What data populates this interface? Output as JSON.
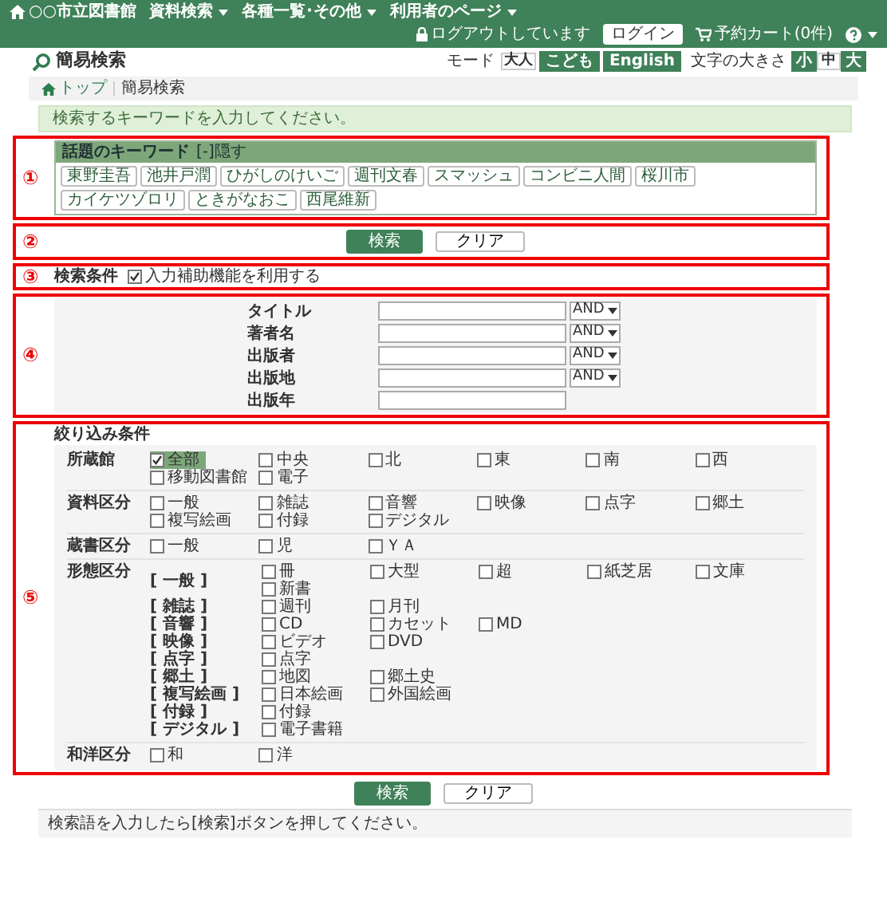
{
  "navbar": {
    "brand": "○○市立図書館",
    "menus": [
      {
        "label": "資料検索"
      },
      {
        "label": "各種一覧･その他"
      },
      {
        "label": "利用者のページ"
      }
    ],
    "login_status": "ログアウトしています",
    "login_button": "ログイン",
    "cart": "予約カート(0件)"
  },
  "page_title": "簡易検索",
  "mode": {
    "label": "モード",
    "options": [
      {
        "label": "大人",
        "selected": true
      },
      {
        "label": "こども",
        "selected": false
      },
      {
        "label": "English",
        "selected": false
      }
    ]
  },
  "font_size": {
    "label": "文字の大きさ",
    "options": [
      {
        "label": "小",
        "selected": false
      },
      {
        "label": "中",
        "selected": true
      },
      {
        "label": "大",
        "selected": false
      }
    ]
  },
  "breadcrumb": [
    {
      "label": "トップ"
    },
    {
      "label": "簡易検索"
    }
  ],
  "message": "検索するキーワードを入力してください。",
  "keywords": {
    "marker": "①",
    "title": "話題のキーワード",
    "toggle": "[-]隠す",
    "items": [
      "東野圭吾",
      "池井戸潤",
      "ひがしのけいご",
      "週刊文春",
      "スマッシュ",
      "コンビニ人間",
      "桜川市",
      "カイケツゾロリ",
      "ときがなおこ",
      "西尾維新"
    ]
  },
  "actions_top": {
    "marker": "②",
    "search": "検索",
    "clear": "クリア"
  },
  "conditions": {
    "marker": "③",
    "label": "検索条件",
    "assist": {
      "label": "入力補助機能を利用する",
      "checked": true
    }
  },
  "fields": {
    "marker": "④",
    "rows": [
      {
        "label": "タイトル",
        "operator": "AND"
      },
      {
        "label": "著者名",
        "operator": "AND"
      },
      {
        "label": "出版者",
        "operator": "AND"
      },
      {
        "label": "出版地",
        "operator": "AND"
      },
      {
        "label": "出版年"
      }
    ]
  },
  "filters": {
    "marker": "⑤",
    "title": "絞り込み条件",
    "groups": [
      {
        "kind": "simple",
        "label": "所蔵館",
        "options": [
          {
            "label": "全部",
            "checked": true
          },
          {
            "label": "中央",
            "checked": false
          },
          {
            "label": "北",
            "checked": false
          },
          {
            "label": "東",
            "checked": false
          },
          {
            "label": "南",
            "checked": false
          },
          {
            "label": "西",
            "checked": false
          },
          {
            "label": "移動図書館",
            "checked": false
          },
          {
            "label": "電子",
            "checked": false
          }
        ]
      },
      {
        "kind": "simple",
        "label": "資料区分",
        "options": [
          {
            "label": "一般",
            "checked": false
          },
          {
            "label": "雑誌",
            "checked": false
          },
          {
            "label": "音響",
            "checked": false
          },
          {
            "label": "映像",
            "checked": false
          },
          {
            "label": "点字",
            "checked": false
          },
          {
            "label": "郷土",
            "checked": false
          },
          {
            "label": "複写絵画",
            "checked": false
          },
          {
            "label": "付録",
            "checked": false
          },
          {
            "label": "デジタル",
            "checked": false
          }
        ]
      },
      {
        "kind": "simple",
        "label": "蔵書区分",
        "options": [
          {
            "label": "一般",
            "checked": false
          },
          {
            "label": "児",
            "checked": false
          },
          {
            "label": "ＹＡ",
            "checked": false
          }
        ]
      },
      {
        "kind": "nested",
        "label": "形態区分",
        "subgroups": [
          {
            "label": "[ 一般 ]",
            "options": [
              {
                "label": "冊",
                "checked": false
              },
              {
                "label": "大型",
                "checked": false
              },
              {
                "label": "超",
                "checked": false
              },
              {
                "label": "紙芝居",
                "checked": false
              },
              {
                "label": "文庫",
                "checked": false
              },
              {
                "label": "新書",
                "checked": false
              }
            ]
          },
          {
            "label": "[ 雑誌 ]",
            "options": [
              {
                "label": "週刊",
                "checked": false
              },
              {
                "label": "月刊",
                "checked": false
              }
            ]
          },
          {
            "label": "[ 音響 ]",
            "options": [
              {
                "label": "CD",
                "checked": false
              },
              {
                "label": "カセット",
                "checked": false
              },
              {
                "label": "MD",
                "checked": false
              }
            ]
          },
          {
            "label": "[ 映像 ]",
            "options": [
              {
                "label": "ビデオ",
                "checked": false
              },
              {
                "label": "DVD",
                "checked": false
              }
            ]
          },
          {
            "label": "[ 点字 ]",
            "options": [
              {
                "label": "点字",
                "checked": false
              }
            ]
          },
          {
            "label": "[ 郷土 ]",
            "options": [
              {
                "label": "地図",
                "checked": false
              },
              {
                "label": "郷土史",
                "checked": false
              }
            ]
          },
          {
            "label": "[ 複写絵画 ]",
            "options": [
              {
                "label": "日本絵画",
                "checked": false
              },
              {
                "label": "外国絵画",
                "checked": false
              }
            ]
          },
          {
            "label": "[ 付録 ]",
            "options": [
              {
                "label": "付録",
                "checked": false
              }
            ]
          },
          {
            "label": "[ デジタル ]",
            "options": [
              {
                "label": "電子書籍",
                "checked": false
              }
            ]
          }
        ]
      },
      {
        "kind": "simple",
        "label": "和洋区分",
        "options": [
          {
            "label": "和",
            "checked": false
          },
          {
            "label": "洋",
            "checked": false
          }
        ]
      }
    ]
  },
  "actions_bottom": {
    "search": "検索",
    "clear": "クリア"
  },
  "footer": "検索語を入力したら[検索]ボタンを押してください。"
}
